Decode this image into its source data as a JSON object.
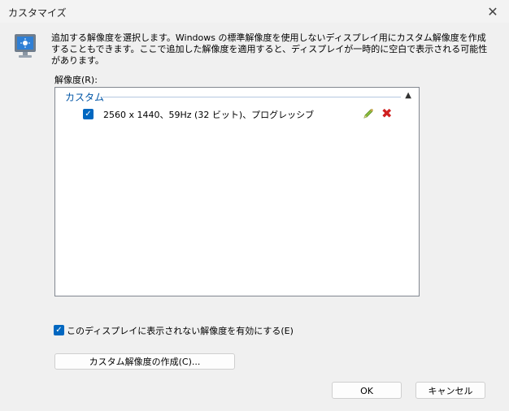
{
  "window": {
    "title": "カスタマイズ",
    "close_icon": "close-icon"
  },
  "description": "追加する解像度を選択します。Windows の標準解像度を使用しないディスプレイ用にカスタム解像度を作成することもできます。ここで追加した解像度を適用すると、ディスプレイが一時的に空白で表示される可能性があります。",
  "resolution_list": {
    "label": "解像度(R):",
    "group_header": "カスタム",
    "items": [
      {
        "text": "2560 x 1440、59Hz (32 ビット)、プログレッシブ",
        "checked": true
      }
    ]
  },
  "options": {
    "enable_hidden_label": "このディスプレイに表示されない解像度を有効にする(E)",
    "enable_hidden_checked": true
  },
  "buttons": {
    "create_custom": "カスタム解像度の作成(C)...",
    "ok": "OK",
    "cancel": "キャンセル"
  },
  "colors": {
    "accent": "#0067c0",
    "group_header": "#0055a6",
    "delete": "#d02020"
  }
}
